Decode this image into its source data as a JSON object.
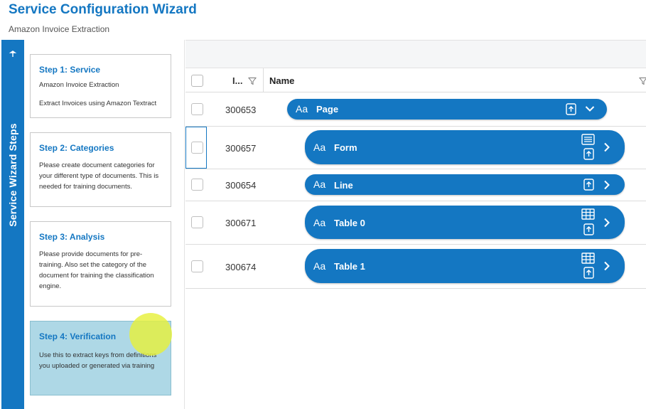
{
  "header": {
    "title": "Service Configuration Wizard",
    "subtitle": "Amazon Invoice Extraction"
  },
  "rail": {
    "label": "Service Wizard Steps",
    "pin_icon": "pin-icon"
  },
  "steps": [
    {
      "title": "Step 1: Service",
      "lines": [
        "Amazon Invoice Extraction",
        "Extract Invoices using Amazon Textract"
      ],
      "active": false
    },
    {
      "title": "Step 2: Categories",
      "lines": [
        "Please create document categories for your different type of documents. This is needed for training documents."
      ],
      "active": false
    },
    {
      "title": "Step 3: Analysis",
      "lines": [
        "Please provide documents for pre-training. Also set the category of the document for training the classification engine."
      ],
      "active": false
    },
    {
      "title": "Step 4: Verification",
      "lines": [
        "Use this to extract keys from definitions you uploaded or generated via training"
      ],
      "active": true
    }
  ],
  "grid": {
    "columns": {
      "id": "I...",
      "name": "Name"
    },
    "rows": [
      {
        "id": "300653",
        "aa": "Aa",
        "label": "Page",
        "icons": [
          "upload-icon"
        ],
        "toggle": "chevron-down-icon"
      },
      {
        "id": "300657",
        "aa": "Aa",
        "label": "Form",
        "icons": [
          "form-list-icon",
          "upload-icon"
        ],
        "toggle": "chevron-right-icon"
      },
      {
        "id": "300654",
        "aa": "Aa",
        "label": "Line",
        "icons": [
          "upload-icon"
        ],
        "toggle": "chevron-right-icon"
      },
      {
        "id": "300671",
        "aa": "Aa",
        "label": "Table 0",
        "icons": [
          "table-grid-icon",
          "upload-icon"
        ],
        "toggle": "chevron-right-icon"
      },
      {
        "id": "300674",
        "aa": "Aa",
        "label": "Table 1",
        "icons": [
          "table-grid-icon",
          "upload-icon"
        ],
        "toggle": "chevron-right-icon"
      }
    ]
  },
  "colors": {
    "brand_blue": "#1477c2",
    "active_step_bg": "#aed8e6",
    "highlight": "#e6f03c"
  }
}
